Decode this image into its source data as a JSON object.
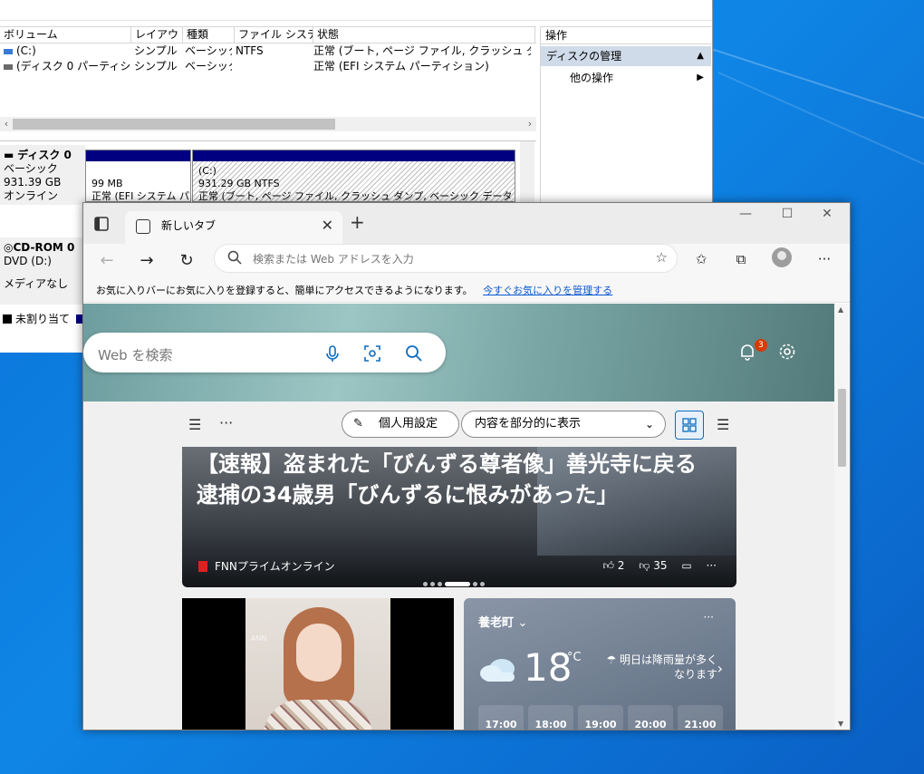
{
  "disk_mgmt": {
    "columns": [
      "ボリューム",
      "レイアウト",
      "種類",
      "ファイル システム",
      "状態"
    ],
    "rows": [
      {
        "volume": "(C:)",
        "layout": "シンプル",
        "type": "ベーシック",
        "fs": "NTFS",
        "status": "正常 (ブート, ページ ファイル, クラッシュ ダンプ, ベーシッ"
      },
      {
        "volume": "(ディスク 0 パーティション 1)",
        "layout": "シンプル",
        "type": "ベーシック",
        "fs": "",
        "status": "正常 (EFI システム パーティション)"
      }
    ],
    "ops_title": "操作",
    "ops_items": [
      "ディスクの管理",
      "他の操作"
    ],
    "disk0": {
      "name": "ディスク 0",
      "type": "ベーシック",
      "size": "931.39 GB",
      "state": "オンライン"
    },
    "partition_efi": {
      "size": "99 MB",
      "status": "正常 (EFI システム パ"
    },
    "partition_c": {
      "label": "(C:)",
      "size": "931.29 GB NTFS",
      "status": "正常 (ブート, ページ ファイル, クラッシュ ダンプ, ベーシック データ パーティシ"
    },
    "cdrom": {
      "name": "CD-ROM 0",
      "drive": "DVD (D:)",
      "media": "メディアなし"
    },
    "legend_unallocated": "未割り当て"
  },
  "edge": {
    "tab_title": "新しいタブ",
    "address_placeholder": "検索または Web アドレスを入力",
    "favbar_text": "お気に入りバーにお気に入りを登録すると、簡単にアクセスできるようになります。",
    "favbar_link": "今すぐお気に入りを管理する",
    "search_placeholder": "Web を検索",
    "notification_count": "3",
    "personalize_label": "個人用設定",
    "content_select": "内容を部分的に表示",
    "news": {
      "headline": "【速報】盗まれた「びんずる尊者像」善光寺に戻る 逮捕の34歳男「びんずるに恨みがあった」",
      "source": "FNNプライムオンライン",
      "likes": "2",
      "dislikes": "35"
    },
    "photo_watermark": "ANN",
    "weather": {
      "location": "養老町",
      "temp": "18",
      "unit": "°C",
      "message": "明日は降雨量が多くなります",
      "hours": [
        "17:00",
        "18:00",
        "19:00",
        "20:00",
        "21:00"
      ]
    }
  }
}
